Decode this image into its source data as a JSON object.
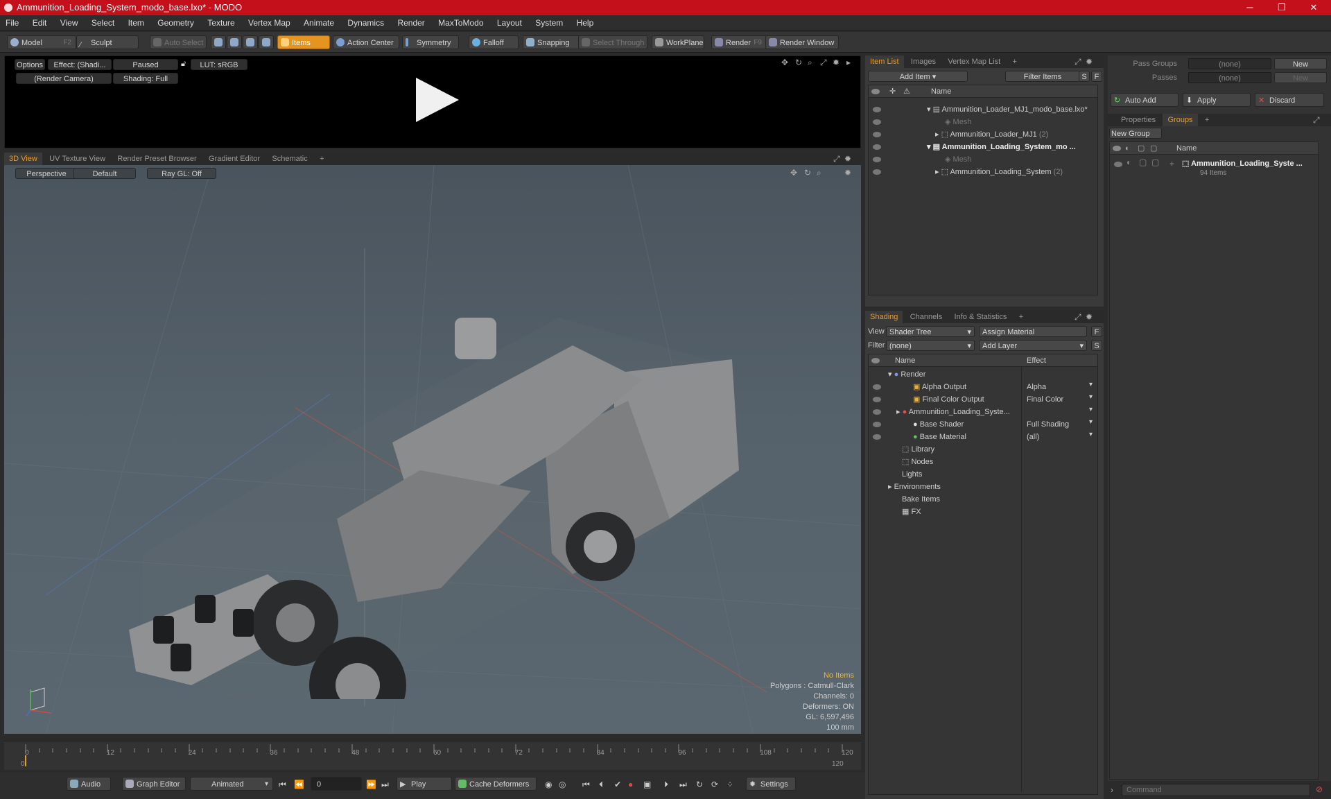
{
  "window": {
    "title": "Ammunition_Loading_System_modo_base.lxo* - MODO"
  },
  "menu": [
    "File",
    "Edit",
    "View",
    "Select",
    "Item",
    "Geometry",
    "Texture",
    "Vertex Map",
    "Animate",
    "Dynamics",
    "Render",
    "MaxToModo",
    "Layout",
    "System",
    "Help"
  ],
  "toolbar": {
    "model": "Model",
    "model_key": "F2",
    "sculpt": "Sculpt",
    "auto_select": "Auto Select",
    "items": "Items",
    "action_center": "Action Center",
    "symmetry": "Symmetry",
    "falloff": "Falloff",
    "snapping": "Snapping",
    "select_through": "Select Through",
    "workplane": "WorkPlane",
    "render": "Render",
    "render_key": "F9",
    "render_window": "Render Window"
  },
  "preview": {
    "options": "Options",
    "effect": "Effect: (Shadi...",
    "paused": "Paused",
    "lut": "LUT: sRGB",
    "camera": "(Render Camera)",
    "shading": "Shading: Full"
  },
  "viewport_tabs": [
    "3D View",
    "UV Texture View",
    "Render Preset Browser",
    "Gradient Editor",
    "Schematic",
    "+"
  ],
  "viewport": {
    "perspective": "Perspective",
    "default": "Default",
    "raygl": "Ray GL: Off"
  },
  "stats": {
    "no_items": "No Items",
    "polygons": "Polygons : Catmull-Clark",
    "channels": "Channels: 0",
    "deformers": "Deformers: ON",
    "gl": "GL: 6,597,496",
    "unit": "100 mm"
  },
  "timeline": {
    "ticks": [
      "0",
      "12",
      "24",
      "36",
      "48",
      "60",
      "72",
      "84",
      "96",
      "108",
      "120"
    ],
    "start": "0",
    "end": "120"
  },
  "bottombar": {
    "audio": "Audio",
    "graph_editor": "Graph Editor",
    "animated": "Animated",
    "frame": "0",
    "play": "Play",
    "cache": "Cache Deformers",
    "settings": "Settings"
  },
  "itemlist": {
    "tabs": [
      "Item List",
      "Images",
      "Vertex Map List",
      "+"
    ],
    "add_item": "Add Item",
    "filter": "Filter Items",
    "s": "S",
    "f": "F",
    "col_name": "Name",
    "rows": [
      {
        "label": "Ammunition_Loader_MJ1_modo_base.lxo*",
        "bold": false
      },
      {
        "label": "Mesh",
        "bold": false
      },
      {
        "label": "Ammunition_Loader_MJ1",
        "count": "(2)",
        "bold": false
      },
      {
        "label": "Ammunition_Loading_System_mo ...",
        "bold": true
      },
      {
        "label": "Mesh",
        "bold": false
      },
      {
        "label": "Ammunition_Loading_System",
        "count": "(2)",
        "bold": false
      }
    ]
  },
  "shading": {
    "tabs": [
      "Shading",
      "Channels",
      "Info & Statistics",
      "+"
    ],
    "view_label": "View",
    "view_value": "Shader Tree",
    "assign": "Assign Material",
    "f": "F",
    "filter_label": "Filter",
    "filter_value": "(none)",
    "add_layer": "Add Layer",
    "s": "S",
    "col_name": "Name",
    "col_effect": "Effect",
    "rows": [
      {
        "name": "Render",
        "effect": ""
      },
      {
        "name": "Alpha Output",
        "effect": "Alpha"
      },
      {
        "name": "Final Color Output",
        "effect": "Final Color"
      },
      {
        "name": "Ammunition_Loading_Syste...",
        "effect": ""
      },
      {
        "name": "Base Shader",
        "effect": "Full Shading"
      },
      {
        "name": "Base Material",
        "effect": "(all)"
      },
      {
        "name": "Library",
        "effect": ""
      },
      {
        "name": "Nodes",
        "effect": ""
      },
      {
        "name": "Lights",
        "effect": ""
      },
      {
        "name": "Environments",
        "effect": ""
      },
      {
        "name": "Bake Items",
        "effect": ""
      },
      {
        "name": "FX",
        "effect": ""
      }
    ]
  },
  "groups": {
    "pass_groups": "Pass Groups",
    "passes": "Passes",
    "none": "(none)",
    "new": "New",
    "auto_add": "Auto Add",
    "apply": "Apply",
    "discard": "Discard",
    "tabs": [
      "Properties",
      "Groups",
      "+"
    ],
    "new_group": "New Group",
    "col_name": "Name",
    "item": "Ammunition_Loading_Syste ...",
    "item_count": "94 Items"
  },
  "command": {
    "placeholder": "Command"
  }
}
